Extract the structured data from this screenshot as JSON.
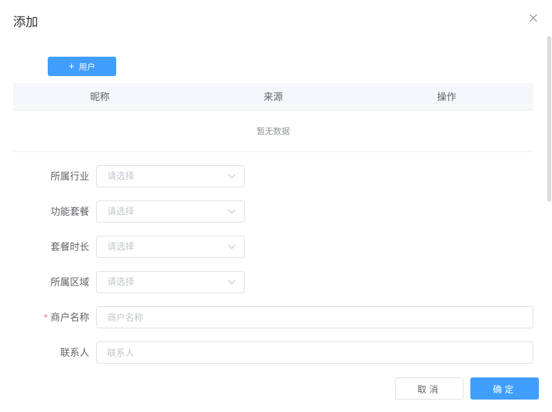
{
  "dialog": {
    "title": "添加"
  },
  "toolbar": {
    "add_user_label": "用户",
    "add_user_icon": "plus-icon"
  },
  "table": {
    "columns": [
      "昵称",
      "来源",
      "操作"
    ],
    "empty_text": "暂无数据"
  },
  "form": {
    "industry": {
      "label": "所属行业",
      "placeholder": "请选择"
    },
    "package": {
      "label": "功能套餐",
      "placeholder": "请选择"
    },
    "duration": {
      "label": "套餐时长",
      "placeholder": "请选择"
    },
    "region": {
      "label": "所属区域",
      "placeholder": "请选择"
    },
    "merchant_name": {
      "label": "商户名称",
      "placeholder": "商户名称",
      "required_mark": "*",
      "value": ""
    },
    "contact": {
      "label": "联系人",
      "placeholder": "联系人",
      "value": ""
    }
  },
  "footer": {
    "cancel_label": "取消",
    "confirm_label": "确定"
  },
  "colors": {
    "primary": "#409eff",
    "required": "#f56c6c",
    "header_bg": "#f5f7fa"
  }
}
